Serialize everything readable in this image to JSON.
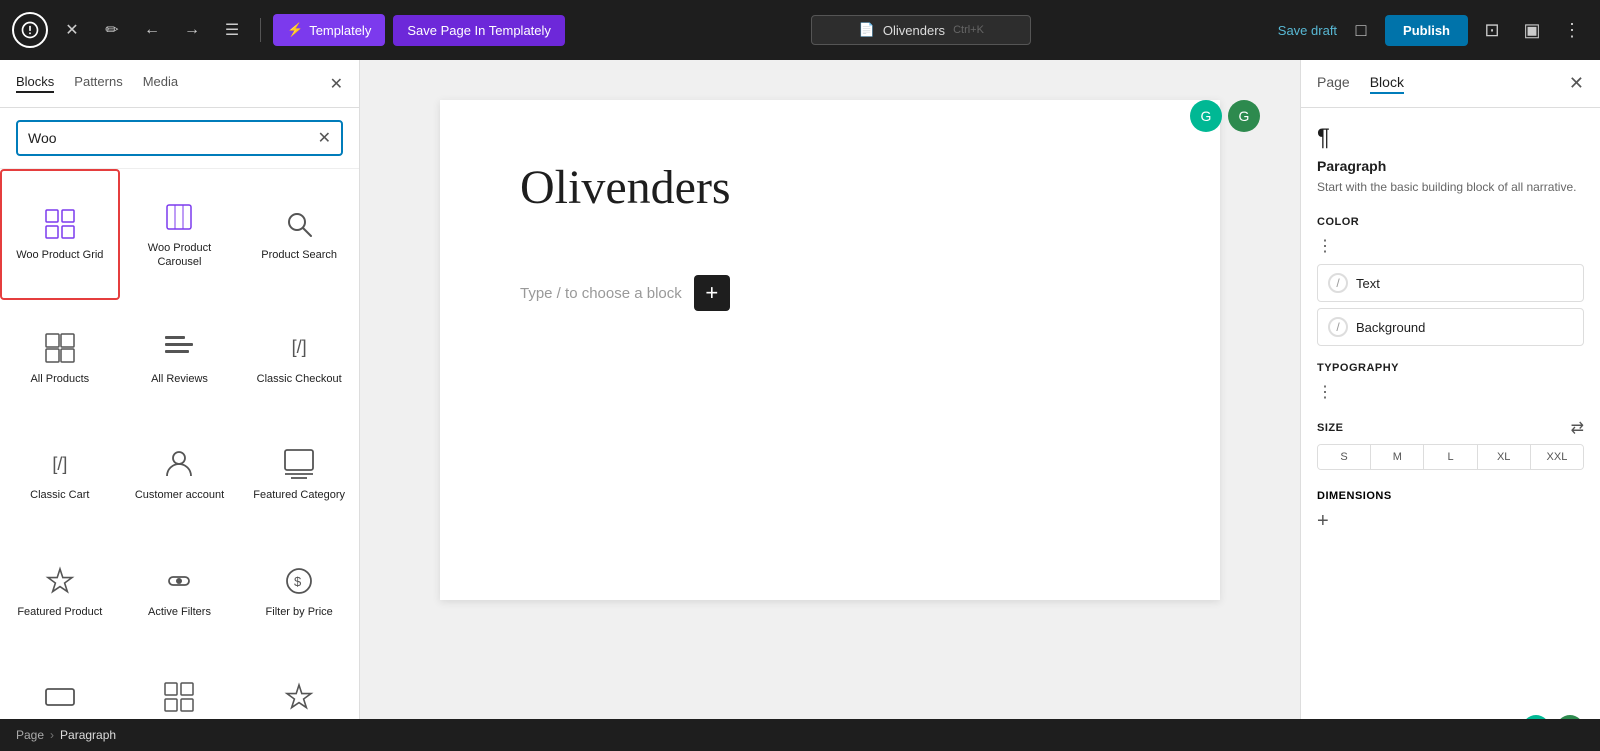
{
  "toolbar": {
    "templately_label": "Templately",
    "save_page_label": "Save Page In Templately",
    "page_name": "Olivenders",
    "shortcut": "Ctrl+K",
    "save_draft_label": "Save draft",
    "publish_label": "Publish"
  },
  "left_sidebar": {
    "tabs": [
      {
        "id": "blocks",
        "label": "Blocks"
      },
      {
        "id": "patterns",
        "label": "Patterns"
      },
      {
        "id": "media",
        "label": "Media"
      }
    ],
    "search_placeholder": "Woo",
    "search_value": "Woo",
    "blocks": [
      {
        "id": "woo-product-grid",
        "label": "Woo Product Grid",
        "icon": "⊞",
        "selected": true
      },
      {
        "id": "woo-product-carousel",
        "label": "Woo Product Carousel",
        "icon": "⊟"
      },
      {
        "id": "product-search",
        "label": "Product Search",
        "icon": "🔍"
      },
      {
        "id": "all-products",
        "label": "All Products",
        "icon": "⊞"
      },
      {
        "id": "all-reviews",
        "label": "All Reviews",
        "icon": "☰"
      },
      {
        "id": "classic-checkout",
        "label": "Classic Checkout",
        "icon": "[/]"
      },
      {
        "id": "classic-cart",
        "label": "Classic Cart",
        "icon": "[/]"
      },
      {
        "id": "customer-account",
        "label": "Customer account",
        "icon": "👤"
      },
      {
        "id": "featured-category",
        "label": "Featured Category",
        "icon": "🗂"
      },
      {
        "id": "featured-product",
        "label": "Featured Product",
        "icon": "☆"
      },
      {
        "id": "active-filters",
        "label": "Active Filters",
        "icon": "⊙"
      },
      {
        "id": "filter-by-price",
        "label": "Filter by Price",
        "icon": "💲"
      },
      {
        "id": "block-13",
        "label": "",
        "icon": "⊟"
      },
      {
        "id": "block-14",
        "label": "",
        "icon": "⊞"
      },
      {
        "id": "block-15",
        "label": "",
        "icon": "☆"
      }
    ]
  },
  "canvas": {
    "page_title": "Olivenders",
    "placeholder_text": "Type / to choose a block"
  },
  "right_sidebar": {
    "tabs": [
      {
        "id": "page",
        "label": "Page"
      },
      {
        "id": "block",
        "label": "Block"
      }
    ],
    "block_info": {
      "title": "Paragraph",
      "description": "Start with the basic building block of all narrative."
    },
    "color_section_title": "Color",
    "colors": [
      {
        "label": "Text"
      },
      {
        "label": "Background"
      }
    ],
    "typography_section_title": "Typography",
    "size_label": "SIZE",
    "sizes": [
      "S",
      "M",
      "L",
      "XL",
      "XXL"
    ],
    "dimensions_label": "Dimensions"
  },
  "breadcrumb": {
    "page": "Page",
    "separator": "›",
    "current": "Paragraph"
  }
}
